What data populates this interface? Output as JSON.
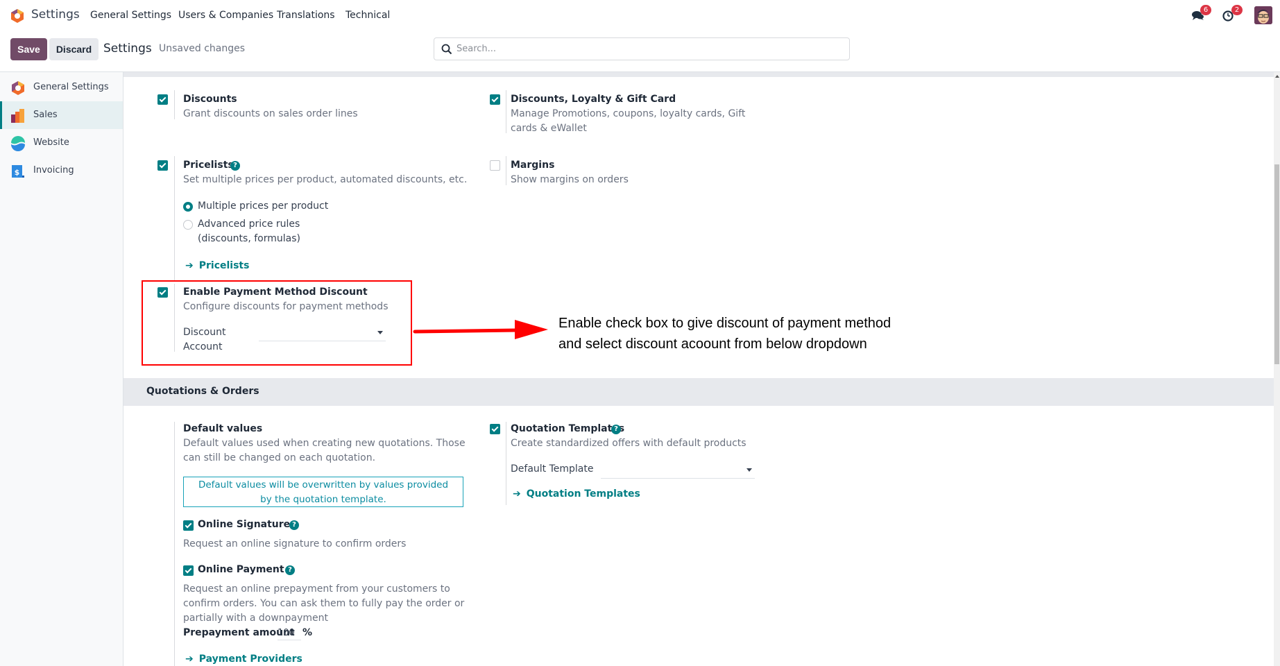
{
  "navbar": {
    "app_name": "Settings",
    "menu": [
      "General Settings",
      "Users & Companies",
      "Translations",
      "Technical"
    ],
    "messages_icon": "chat-bubbles-icon",
    "messages_count": "6",
    "activities_icon": "clock-icon",
    "activities_count": "2",
    "avatar": "user-avatar"
  },
  "control_panel": {
    "save_label": "Save",
    "discard_label": "Discard",
    "title": "Settings",
    "status": "Unsaved changes",
    "search_placeholder": "Search..."
  },
  "sidebar": {
    "items": [
      {
        "label": "General Settings",
        "icon": "odoo-settings-icon",
        "active": false
      },
      {
        "label": "Sales",
        "icon": "sales-chart-icon",
        "active": true
      },
      {
        "label": "Website",
        "icon": "website-icon",
        "active": false
      },
      {
        "label": "Invoicing",
        "icon": "invoicing-icon",
        "active": false
      }
    ]
  },
  "settings": {
    "discounts": {
      "title": "Discounts",
      "desc": "Grant discounts on sales order lines",
      "checked": true
    },
    "loyalty": {
      "title": "Discounts, Loyalty & Gift Card",
      "desc": "Manage Promotions, coupons, loyalty cards, Gift cards & eWallet",
      "checked": true
    },
    "pricelists": {
      "title": "Pricelists",
      "desc": "Set multiple prices per product, automated discounts, etc.",
      "checked": true,
      "options": [
        "Multiple prices per product",
        "Advanced price rules (discounts, formulas)"
      ],
      "option_line1": "Advanced price rules",
      "option_line2": "(discounts, formulas)",
      "selected_option": "Multiple prices per product",
      "link": "Pricelists"
    },
    "margins": {
      "title": "Margins",
      "desc": "Show margins on orders",
      "checked": false
    },
    "payment_discount": {
      "title": "Enable Payment Method Discount",
      "desc": "Configure discounts for payment methods",
      "checked": true,
      "field_label_1": "Discount",
      "field_label_2": "Account",
      "field_value": ""
    }
  },
  "quotations": {
    "section_title": "Quotations & Orders",
    "default_values": {
      "title": "Default values",
      "desc": "Default values used when creating new quotations. Those can still be changed on each quotation.",
      "info_line1": "Default values will be overwritten by values provided",
      "info_line2": "by the quotation template."
    },
    "online_signature": {
      "title": "Online Signature",
      "desc": "Request an online signature to confirm orders",
      "checked": true
    },
    "online_payment": {
      "title": "Online Payment",
      "desc": "Request an online prepayment from your customers to confirm orders. You can ask them to fully pay the order or partially with a downpayment",
      "checked": true,
      "prepayment_label": "Prepayment amount",
      "prepayment_value": "100",
      "prepayment_unit": "%",
      "link": "Payment Providers"
    },
    "quotation_templates": {
      "title": "Quotation Templates",
      "desc": "Create standardized offers with default products",
      "checked": true,
      "field_label": "Default Template",
      "field_value": "",
      "link": "Quotation Templates"
    }
  },
  "annotation": {
    "line1": "Enable check box to give discount of payment method",
    "line2": "and select discount acoount from below dropdown",
    "color": "#ff0000"
  },
  "colors": {
    "brand": "#714b67",
    "accent": "#017e84",
    "badge": "#dc3545"
  }
}
